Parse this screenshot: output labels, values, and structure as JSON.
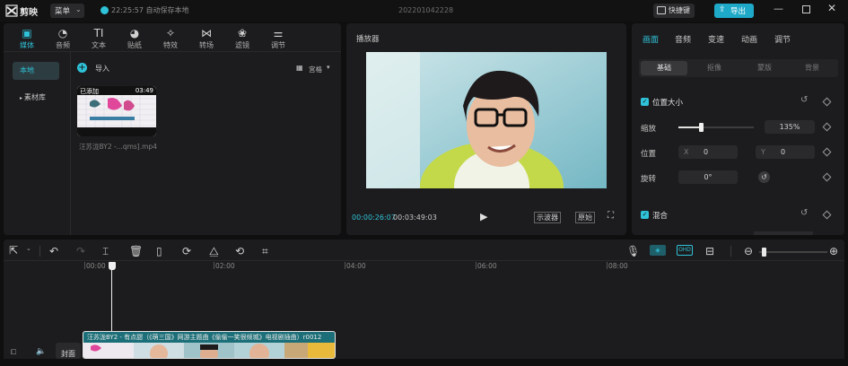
{
  "titlebar": {
    "app_name": "剪映",
    "menu_label": "菜单",
    "autosave": "22:25:57 自动保存本地",
    "project_name": "202201042228",
    "shortcut_label": "快捷键",
    "export_label": "导出"
  },
  "toolbar": {
    "items": [
      {
        "icon": "media-icon",
        "label": "媒体"
      },
      {
        "icon": "audio-icon",
        "label": "音频"
      },
      {
        "icon": "text-icon",
        "label": "文本"
      },
      {
        "icon": "sticker-icon",
        "label": "贴纸"
      },
      {
        "icon": "effects-icon",
        "label": "特效"
      },
      {
        "icon": "transition-icon",
        "label": "转场"
      },
      {
        "icon": "filter-icon",
        "label": "滤镜"
      },
      {
        "icon": "adjust-icon",
        "label": "调节"
      }
    ]
  },
  "media": {
    "local_label": "本地",
    "library_label": "素材库",
    "import_label": "导入",
    "view_label": "宫格",
    "clip": {
      "added_badge": "已添加",
      "duration": "03:49",
      "filename": "汪苏泷BY2 -...qms].mp4"
    }
  },
  "player": {
    "title": "播放器",
    "current_time": "00:00:26:07",
    "total_time": "00:03:49:03",
    "waveform_label": "示波器",
    "original_label": "原始"
  },
  "inspector": {
    "tabs": [
      "画面",
      "音频",
      "变速",
      "动画",
      "调节"
    ],
    "subtabs": [
      "基础",
      "抠像",
      "蒙版",
      "背景"
    ],
    "position_size_label": "位置大小",
    "scale_label": "缩放",
    "scale_value": "135%",
    "scale_fraction": 0.3,
    "position_label": "位置",
    "x_label": "X",
    "x_value": "0",
    "y_label": "Y",
    "y_value": "0",
    "rotate_label": "旋转",
    "rotate_value": "0°",
    "blend_label": "混合"
  },
  "timeline": {
    "ruler": [
      "00:00",
      "02:00",
      "04:00",
      "06:00",
      "08:00"
    ],
    "cover_label": "封面",
    "clip_title": "汪苏泷BY2 - 有点甜（《萌三国》网游主题曲《偷偷一笑很倾城》电视剧插曲）r0012"
  },
  "colors": {
    "accent": "#2fc2d8",
    "export_bg": "#1fa9c9",
    "clip_bar": "#1c6f78"
  }
}
